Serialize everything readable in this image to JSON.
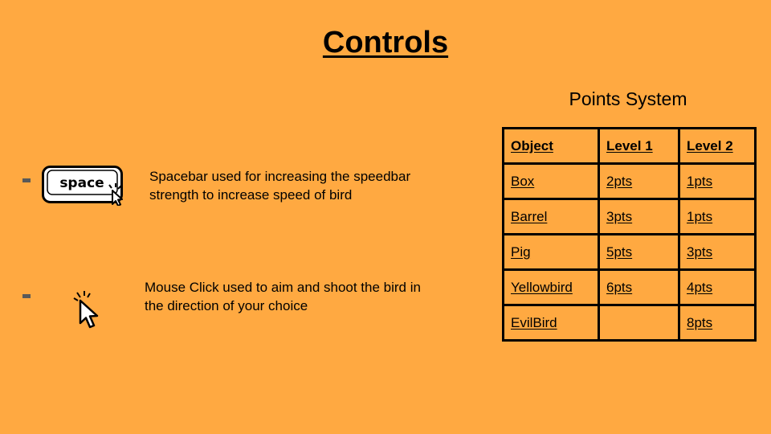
{
  "title": "Controls",
  "controls": [
    {
      "icon": "spacebar-key-icon",
      "key_label": "space",
      "description": "Spacebar used for increasing the speedbar strength to increase speed of bird"
    },
    {
      "icon": "mouse-pointer-click-icon",
      "description": "Mouse Click used to aim and shoot the bird in the direction of your choice"
    }
  ],
  "points": {
    "title": "Points System",
    "headers": [
      "Object",
      "Level 1",
      "Level 2"
    ],
    "rows": [
      [
        "Box",
        "2pts",
        "1pts"
      ],
      [
        "Barrel",
        "3pts",
        "1pts"
      ],
      [
        "Pig",
        "5pts",
        "3pts"
      ],
      [
        "Yellowbird",
        "6pts",
        "4pts"
      ],
      [
        "EvilBird",
        "",
        "8pts"
      ]
    ]
  },
  "colors": {
    "background": "#FFA941",
    "bullet": "#595959"
  }
}
